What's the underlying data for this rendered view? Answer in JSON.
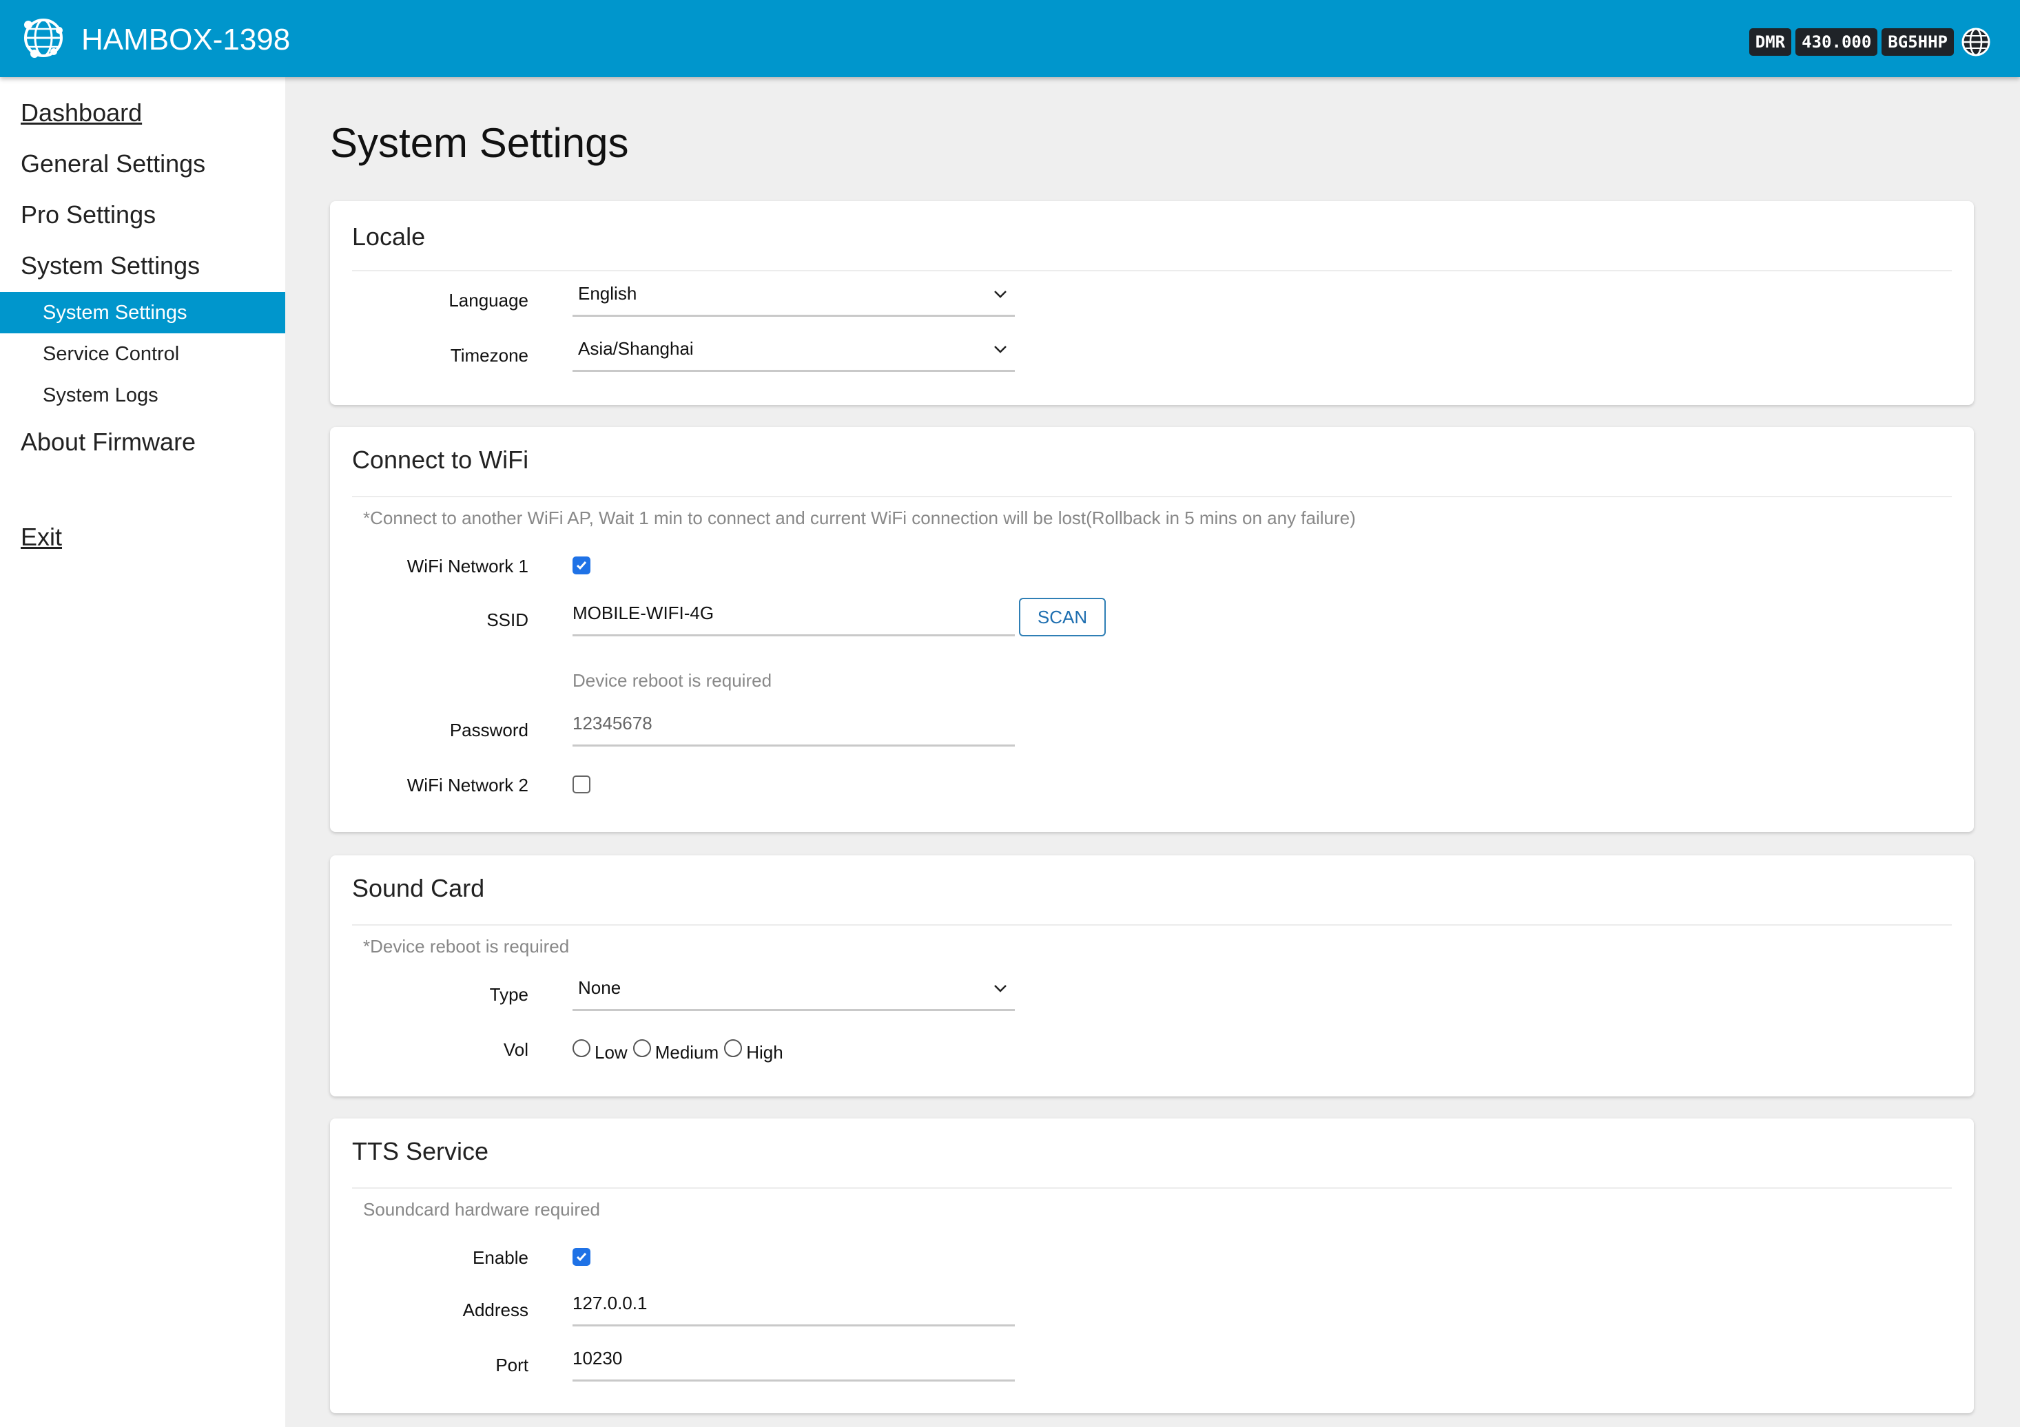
{
  "header": {
    "title": "HAMBOX-1398",
    "badges": [
      "DMR",
      "430.000",
      "BG5HHP"
    ],
    "logo_icon": "globe-network-logo-icon",
    "status_icon": "globe-icon",
    "background_color": "#0096cc"
  },
  "sidebar": {
    "items": [
      {
        "label": "Dashboard"
      },
      {
        "label": "General Settings"
      },
      {
        "label": "Pro Settings"
      },
      {
        "label": "System Settings"
      },
      {
        "label": "System Settings",
        "active": true
      },
      {
        "label": "Service Control"
      },
      {
        "label": "System Logs"
      },
      {
        "label": "About Firmware"
      },
      {
        "label": "Exit"
      }
    ]
  },
  "page": {
    "title": "System Settings"
  },
  "locale": {
    "title": "Locale",
    "language_label": "Language",
    "language_value": "English",
    "timezone_label": "Timezone",
    "timezone_value": "Asia/Shanghai"
  },
  "wifi": {
    "title": "Connect to WiFi",
    "note": "*Connect to another WiFi AP, Wait 1 min to connect and current WiFi connection will be lost(Rollback in 5 mins on any failure)",
    "network1_label": "WiFi Network 1",
    "network1_checked": true,
    "ssid_label": "SSID",
    "ssid_value": "MOBILE-WIFI-4G",
    "scan_label": "SCAN",
    "reboot_note": "Device reboot is required",
    "password_label": "Password",
    "password_value": "12345678",
    "network2_label": "WiFi Network 2",
    "network2_checked": false
  },
  "sound": {
    "title": "Sound Card",
    "note": "*Device reboot is required",
    "type_label": "Type",
    "type_value": "None",
    "vol_label": "Vol",
    "vol_options": [
      "Low",
      "Medium",
      "High"
    ]
  },
  "tts": {
    "title": "TTS Service",
    "note": "Soundcard hardware required",
    "enable_label": "Enable",
    "enable_checked": true,
    "address_label": "Address",
    "address_value": "127.0.0.1",
    "port_label": "Port",
    "port_value": "10230"
  },
  "colors": {
    "accent": "#0096cc",
    "checkbox": "#1f72e6",
    "page_bg": "#efefef"
  }
}
